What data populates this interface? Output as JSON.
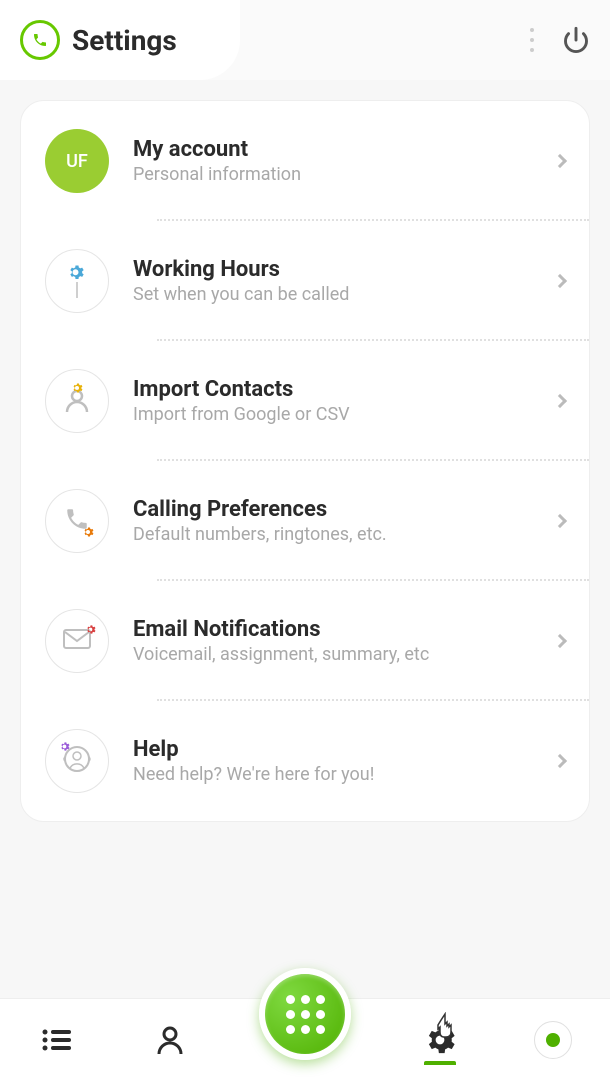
{
  "header": {
    "title": "Settings"
  },
  "avatar": {
    "initials": "UF"
  },
  "items": [
    {
      "title": "My account",
      "subtitle": "Personal information",
      "icon": "avatar"
    },
    {
      "title": "Working Hours",
      "subtitle": "Set when you can be called",
      "icon": "gear-stick"
    },
    {
      "title": "Import Contacts",
      "subtitle": "Import from Google or CSV",
      "icon": "person-gear"
    },
    {
      "title": "Calling Preferences",
      "subtitle": "Default numbers, ringtones, etc.",
      "icon": "phone-gear"
    },
    {
      "title": "Email Notifications",
      "subtitle": "Voicemail, assignment, summary, etc",
      "icon": "mail-gear"
    },
    {
      "title": "Help",
      "subtitle": "Need help? We're here for you!",
      "icon": "support-gear"
    }
  ],
  "colors": {
    "accent": "#67c800",
    "textPrimary": "#2b2b2b",
    "textSecondary": "#a8a8a8"
  }
}
